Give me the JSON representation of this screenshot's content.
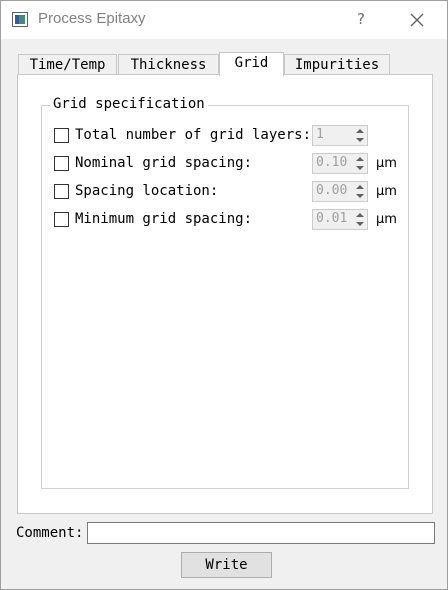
{
  "window": {
    "title": "Process Epitaxy",
    "help_label": "?"
  },
  "tabs": [
    {
      "label": "Time/Temp",
      "active": false
    },
    {
      "label": "Thickness",
      "active": false
    },
    {
      "label": "Grid",
      "active": true
    },
    {
      "label": "Impurities",
      "active": false
    }
  ],
  "grid": {
    "group_title": "Grid specification",
    "rows": [
      {
        "label": "Total number of grid layers:",
        "value": "1",
        "unit": "",
        "checked": false
      },
      {
        "label": "Nominal grid spacing:",
        "value": "0.10",
        "unit": "µm",
        "checked": false
      },
      {
        "label": "Spacing location:",
        "value": "0.00",
        "unit": "µm",
        "checked": false
      },
      {
        "label": "Minimum grid spacing:",
        "value": "0.01",
        "unit": "µm",
        "checked": false
      }
    ]
  },
  "comment": {
    "label": "Comment:",
    "value": "",
    "placeholder": ""
  },
  "actions": {
    "write_label": "Write"
  },
  "colors": {
    "window_bg": "#f0f0f0",
    "pane_bg": "#ffffff",
    "disabled_text": "#a0a0a0"
  }
}
